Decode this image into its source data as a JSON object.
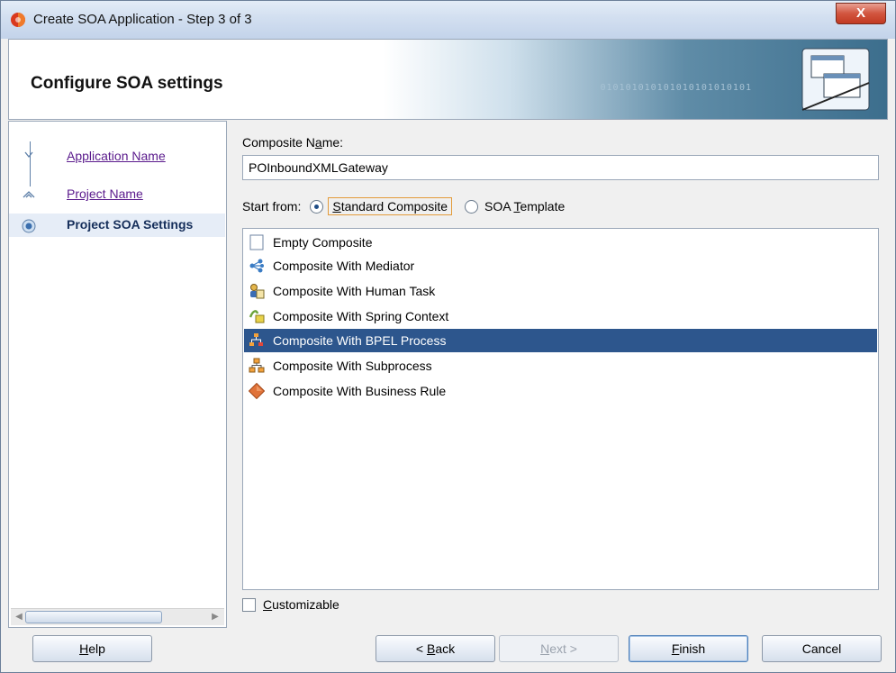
{
  "window": {
    "title": "Create SOA Application - Step 3 of 3",
    "close_label": "X"
  },
  "banner": {
    "heading": "Configure SOA settings",
    "bits_text": "010101010101010101010101"
  },
  "steps": [
    {
      "label": "Application Name",
      "state": "done"
    },
    {
      "label": "Project Name",
      "state": "done"
    },
    {
      "label": "Project SOA Settings",
      "state": "current"
    }
  ],
  "form": {
    "composite_name_label_pre": "Composite N",
    "composite_name_label_mnemonic": "a",
    "composite_name_label_post": "me:",
    "composite_name_value": "POInboundXMLGateway",
    "start_from_label": "Start from:",
    "standard_composite_mnemonic": "S",
    "standard_composite_rest": "tandard Composite",
    "soa_template_pre": "SOA ",
    "soa_template_mnemonic": "T",
    "soa_template_post": "emplate",
    "customizable_mnemonic": "C",
    "customizable_rest": "ustomizable"
  },
  "templates": [
    {
      "label": "Empty Composite",
      "icon": "empty-composite-icon",
      "selected": false
    },
    {
      "label": "Composite With Mediator",
      "icon": "mediator-icon",
      "selected": false
    },
    {
      "label": "Composite With Human Task",
      "icon": "human-task-icon",
      "selected": false
    },
    {
      "label": "Composite With Spring Context",
      "icon": "spring-context-icon",
      "selected": false
    },
    {
      "label": "Composite With BPEL Process",
      "icon": "bpel-process-icon",
      "selected": true
    },
    {
      "label": "Composite With Subprocess",
      "icon": "subprocess-icon",
      "selected": false
    },
    {
      "label": "Composite With Business Rule",
      "icon": "business-rule-icon",
      "selected": false
    }
  ],
  "buttons": {
    "help_mnemonic": "H",
    "help_rest": "elp",
    "back_pre": "< ",
    "back_mnemonic": "B",
    "back_rest": "ack",
    "next_mnemonic": "N",
    "next_rest": "ext >",
    "finish_mnemonic": "F",
    "finish_rest": "inish",
    "cancel": "Cancel"
  },
  "colors": {
    "selection": "#2d568d",
    "link": "#5a1a8c",
    "close_button": "#c23a22"
  }
}
